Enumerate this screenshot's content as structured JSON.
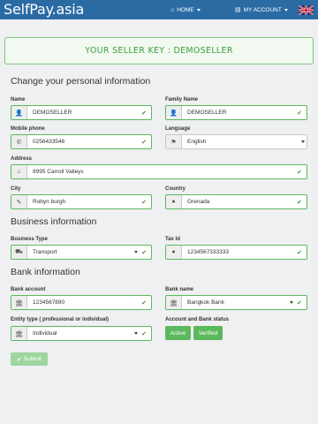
{
  "header": {
    "brand": "SelfPay.asia",
    "nav_home": "HOME",
    "nav_account": "MY ACCOUNT"
  },
  "seller_key": "YOUR SELLER KEY : DEMOSELLER",
  "sections": {
    "personal": "Change your personal information",
    "business": "Business information",
    "bank": "Bank information"
  },
  "fields": {
    "name": {
      "label": "Name",
      "value": "DEMOSELLER"
    },
    "family_name": {
      "label": "Family Name",
      "value": "DEMOSELLER"
    },
    "mobile": {
      "label": "Mobile phone",
      "value": "0256433546"
    },
    "language": {
      "label": "Language",
      "value": "English"
    },
    "address": {
      "label": "Address",
      "value": "8995 Carroll Valleys"
    },
    "city": {
      "label": "City",
      "value": "Robyn burgh"
    },
    "country": {
      "label": "Country",
      "value": "Grenada"
    },
    "business_type": {
      "label": "Business Type",
      "value": "Transport"
    },
    "tax_id": {
      "label": "Tax Id",
      "value": "1234567333333"
    },
    "bank_account": {
      "label": "Bank account",
      "value": "1234567890"
    },
    "bank_name": {
      "label": "Bank name",
      "value": "Bangkok Bank"
    },
    "entity_type": {
      "label": "Entity type ( professional or individual)",
      "value": "Individual"
    }
  },
  "status": {
    "label": "Account and Bank status",
    "account": "Active",
    "bank": "Verified"
  },
  "submit_label": "Submit",
  "colors": {
    "header_bg": "#2b6ba4",
    "accent_green": "#5cb85c",
    "submit_disabled": "#9fd59f"
  }
}
